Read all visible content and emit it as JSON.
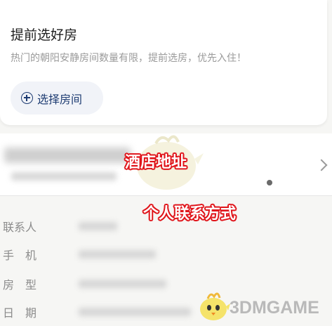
{
  "booking_card": {
    "title": "提前选好房",
    "subtitle": "热门的朝阳安静房间数量有限，提前选房，优先入住！",
    "select_button_label": "选择房间",
    "select_icon": "plus-circle-icon"
  },
  "hotel": {
    "chevron_icon": "chevron-right-icon"
  },
  "annotations": {
    "hotel_address": "酒店地址",
    "contact_info": "个人联系方式"
  },
  "info_rows": [
    {
      "label": "联系人"
    },
    {
      "label": "手　机"
    },
    {
      "label": "房　型"
    },
    {
      "label": "日　期"
    }
  ],
  "watermark": {
    "text": "3DMGAME"
  },
  "colors": {
    "accent": "#1e3c72",
    "annotation_red": "#e0141a"
  }
}
